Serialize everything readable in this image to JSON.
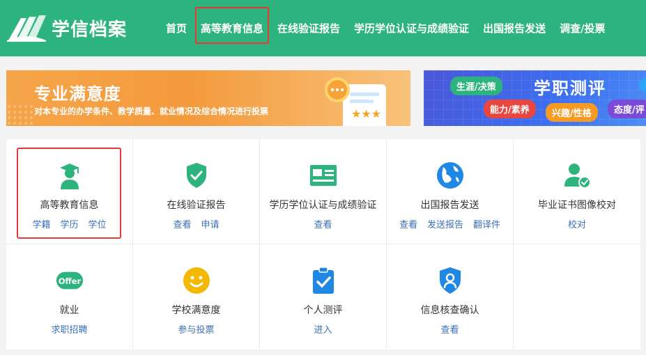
{
  "header": {
    "logo_text": "学信档案",
    "nav": [
      {
        "label": "首页"
      },
      {
        "label": "高等教育信息"
      },
      {
        "label": "在线验证报告"
      },
      {
        "label": "学历学位认证与成绩验证"
      },
      {
        "label": "出国报告发送"
      },
      {
        "label": "调查/投票"
      }
    ]
  },
  "banner_left": {
    "title": "专业满意度",
    "subtitle": "对本专业的办学条件、教学质量、就业情况及综合情况进行投票"
  },
  "banner_right": {
    "title": "学职测评",
    "pills": [
      "生涯/决策",
      "能力/素养",
      "兴趣/性格",
      "态度/评"
    ]
  },
  "services": [
    {
      "label": "高等教育信息",
      "links": [
        "学籍",
        "学历",
        "学位"
      ],
      "icon": "graduate-icon"
    },
    {
      "label": "在线验证报告",
      "links": [
        "查看",
        "申请"
      ],
      "icon": "shield-check-icon"
    },
    {
      "label": "学历学位认证与成绩验证",
      "links": [
        "查看"
      ],
      "icon": "id-card-icon"
    },
    {
      "label": "出国报告发送",
      "links": [
        "查看",
        "发送报告",
        "翻译件"
      ],
      "icon": "globe-icon"
    },
    {
      "label": "毕业证书图像校对",
      "links": [
        "校对"
      ],
      "icon": "user-check-icon"
    },
    {
      "label": "就业",
      "links": [
        "求职招聘"
      ],
      "icon": "offer-icon",
      "badge": "Offer"
    },
    {
      "label": "学校满意度",
      "links": [
        "参与投票"
      ],
      "icon": "smiley-icon"
    },
    {
      "label": "个人测评",
      "links": [
        "进入"
      ],
      "icon": "clipboard-check-icon"
    },
    {
      "label": "信息核查确认",
      "links": [
        "查看"
      ],
      "icon": "user-shield-icon"
    }
  ],
  "colors": {
    "brand_green": "#2db37d",
    "link_blue": "#3a6fb7",
    "highlight_red": "#e53935"
  }
}
